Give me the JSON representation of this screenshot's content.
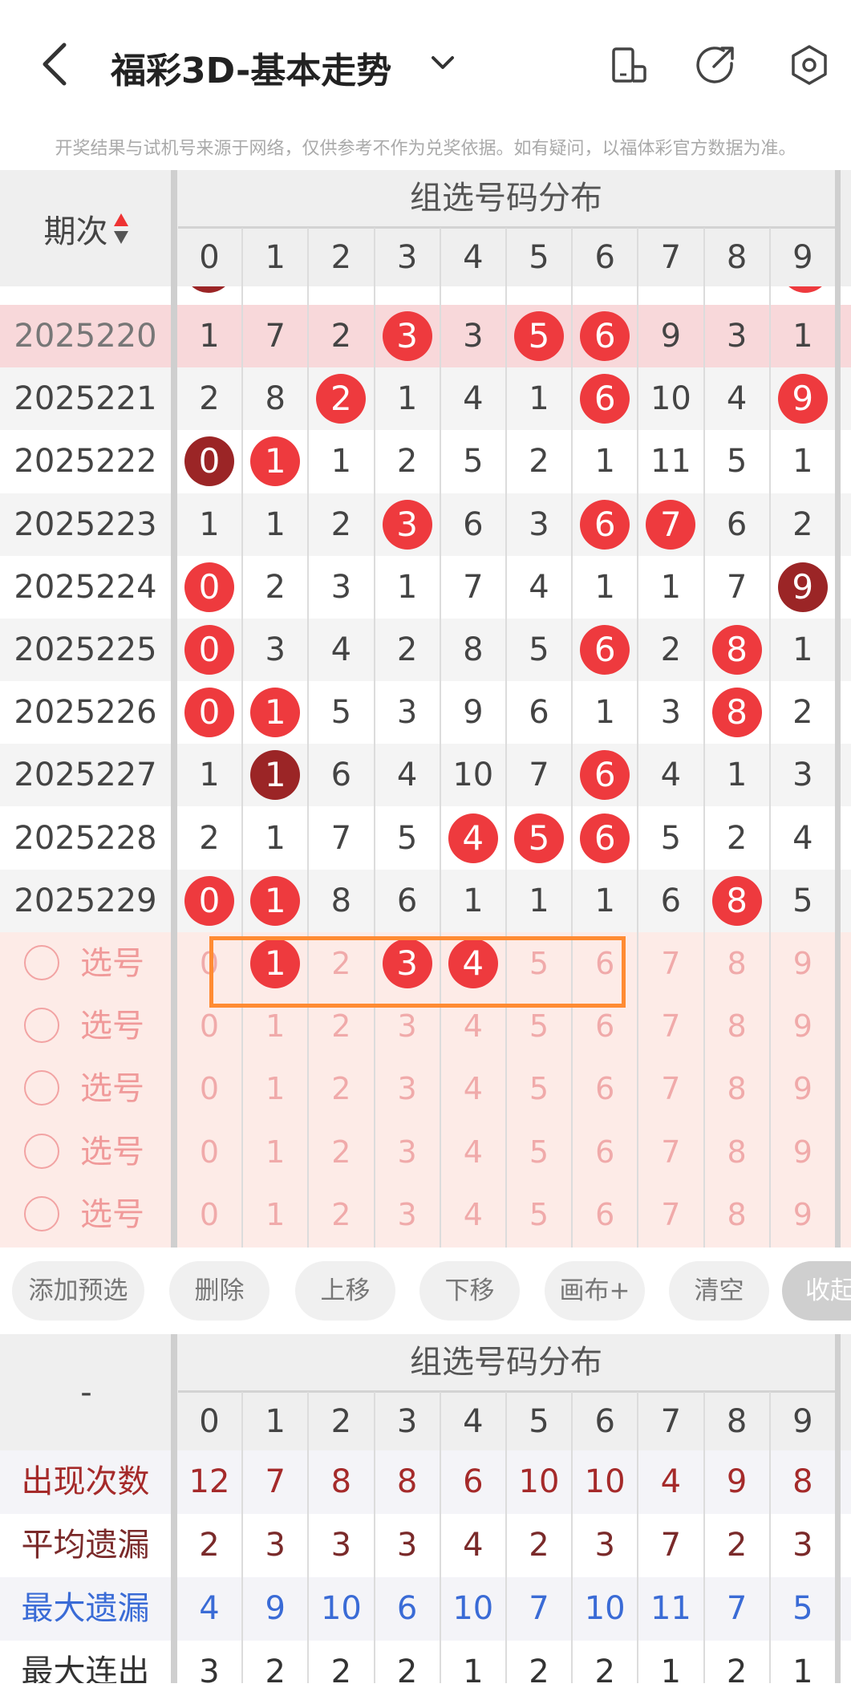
{
  "header": {
    "title": "福彩3D-基本走势",
    "icons": [
      "back-icon",
      "chevron-down-icon",
      "device-rotate-icon",
      "share-icon",
      "settings-icon"
    ]
  },
  "notice": "开奖结果与试机号来源于网络，仅供参考不作为兑奖依据。如有疑问，以福体彩官方数据为准。",
  "grid": {
    "period_header": "期次",
    "group_title": "组选号码分布",
    "digits": [
      "0",
      "1",
      "2",
      "3",
      "4",
      "5",
      "6",
      "7",
      "8",
      "9"
    ],
    "rows": [
      {
        "period": "2025220",
        "values": [
          "1",
          "7",
          "2",
          "3",
          "3",
          "5",
          "6",
          "9",
          "3",
          "1"
        ],
        "hits": [
          3,
          5,
          6
        ],
        "style": "hl"
      },
      {
        "period": "2025221",
        "values": [
          "2",
          "8",
          "2",
          "1",
          "4",
          "1",
          "6",
          "10",
          "4",
          "9"
        ],
        "hits": [
          2,
          6,
          9
        ],
        "style": "alt"
      },
      {
        "period": "2025222",
        "values": [
          "0",
          "1",
          "1",
          "2",
          "5",
          "2",
          "1",
          "11",
          "5",
          "1"
        ],
        "hits": [
          0,
          1
        ],
        "dark": [
          0
        ],
        "style": "white"
      },
      {
        "period": "2025223",
        "values": [
          "1",
          "1",
          "2",
          "3",
          "6",
          "3",
          "6",
          "7",
          "6",
          "2"
        ],
        "hits": [
          3,
          6,
          7
        ],
        "style": "alt"
      },
      {
        "period": "2025224",
        "values": [
          "0",
          "2",
          "3",
          "1",
          "7",
          "4",
          "1",
          "1",
          "7",
          "9"
        ],
        "hits": [
          0,
          9
        ],
        "dark": [
          9
        ],
        "style": "white"
      },
      {
        "period": "2025225",
        "values": [
          "0",
          "3",
          "4",
          "2",
          "8",
          "5",
          "6",
          "2",
          "8",
          "1"
        ],
        "hits": [
          0,
          6,
          8
        ],
        "style": "alt"
      },
      {
        "period": "2025226",
        "values": [
          "0",
          "1",
          "5",
          "3",
          "9",
          "6",
          "1",
          "3",
          "8",
          "2"
        ],
        "hits": [
          0,
          1,
          8
        ],
        "style": "white"
      },
      {
        "period": "2025227",
        "values": [
          "1",
          "1",
          "6",
          "4",
          "10",
          "7",
          "6",
          "4",
          "1",
          "3"
        ],
        "hits": [
          1,
          6
        ],
        "dark": [
          1
        ],
        "style": "alt"
      },
      {
        "period": "2025228",
        "values": [
          "2",
          "1",
          "7",
          "5",
          "4",
          "5",
          "6",
          "5",
          "2",
          "4"
        ],
        "hits": [
          4,
          5,
          6
        ],
        "style": "white"
      },
      {
        "period": "2025229",
        "values": [
          "0",
          "1",
          "8",
          "6",
          "1",
          "1",
          "1",
          "6",
          "8",
          "5"
        ],
        "hits": [
          0,
          1,
          8
        ],
        "style": "alt"
      }
    ]
  },
  "select": {
    "label": "选号",
    "rows": [
      {
        "selected": [
          1,
          3,
          4
        ]
      },
      {
        "selected": []
      },
      {
        "selected": []
      },
      {
        "selected": []
      },
      {
        "selected": []
      }
    ]
  },
  "actions": [
    "添加预选",
    "删除",
    "上移",
    "下移",
    "画布+",
    "清空",
    "收起"
  ],
  "stats": {
    "corner": "-",
    "group_title": "组选号码分布",
    "rows": [
      {
        "label": "出现次数",
        "color": "#a52a2a",
        "values": [
          "12",
          "7",
          "8",
          "8",
          "6",
          "10",
          "10",
          "4",
          "9",
          "8"
        ]
      },
      {
        "label": "平均遗漏",
        "color": "#7a2a2a",
        "values": [
          "2",
          "3",
          "3",
          "3",
          "4",
          "2",
          "3",
          "7",
          "2",
          "3"
        ]
      },
      {
        "label": "最大遗漏",
        "color": "#3a6bd6",
        "values": [
          "4",
          "9",
          "10",
          "6",
          "10",
          "7",
          "10",
          "11",
          "7",
          "5"
        ]
      },
      {
        "label": "最大连出",
        "color": "#333333",
        "values": [
          "3",
          "2",
          "2",
          "2",
          "1",
          "2",
          "2",
          "1",
          "2",
          "1"
        ]
      }
    ]
  },
  "colors": {
    "ball": "#ee3a3e",
    "ball_dark": "#9b2526",
    "highlight_row": "#f8d8da",
    "select_bg": "#fdebe7",
    "select_box": "#ff8b33"
  }
}
